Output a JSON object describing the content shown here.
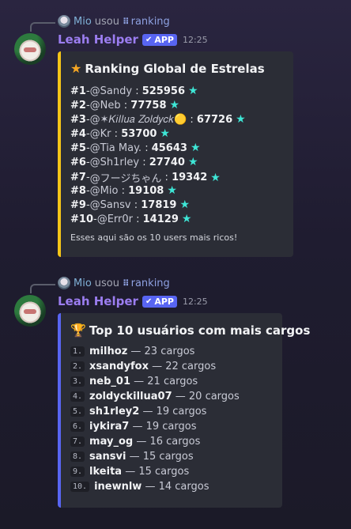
{
  "messages": [
    {
      "reply": {
        "user": "Mio",
        "verb": "usou",
        "command": "ranking"
      },
      "author": "Leah Helper",
      "badge": "APP",
      "time": "12:25",
      "embed": {
        "accent": "#f5c518",
        "title_icon": "star-icon",
        "title": "Ranking Global de Estrelas",
        "rows": [
          {
            "pos": "#1",
            "sep": " - ",
            "user": "@Sandy",
            "value": "525956"
          },
          {
            "pos": "#2",
            "sep": " - ",
            "user": "@Neb",
            "value": "77758"
          },
          {
            "pos": "#3",
            "sep": " - ",
            "user": "@✶𝐾𝑖𝑙𝑙𝑢𝑎 𝑍𝑜𝑙𝑑𝑦𝑐𝑘🟡",
            "value": "67726"
          },
          {
            "pos": "#4",
            "sep": " - ",
            "user": "@Kr",
            "value": "53700"
          },
          {
            "pos": "#5",
            "sep": " - ",
            "user": "@Tia May.",
            "value": "45643"
          },
          {
            "pos": "#6",
            "sep": " - ",
            "user": "@Sh1rley",
            "value": "27740"
          },
          {
            "pos": "#7",
            "sep": " - ",
            "user": "@フージちゃん",
            "value": "19342"
          },
          {
            "pos": "#8",
            "sep": " - ",
            "user": "@Mio",
            "value": "19108"
          },
          {
            "pos": "#9",
            "sep": " - ",
            "user": "@Sansv",
            "value": "17819"
          },
          {
            "pos": "#10",
            "sep": " - ",
            "user": "@Err0r",
            "value": "14129"
          }
        ],
        "footer": "Esses aqui são os 10 users mais ricos!"
      }
    },
    {
      "reply": {
        "user": "Mio",
        "verb": "usou",
        "command": "ranking"
      },
      "author": "Leah Helper",
      "badge": "APP",
      "time": "12:25",
      "embed": {
        "accent": "#5865f2",
        "title_icon": "trophy-icon",
        "title": "Top 10 usuários com mais cargos",
        "rows": [
          {
            "num": "1.",
            "user": "milhoz",
            "count": "— 23 cargos"
          },
          {
            "num": "2.",
            "user": "xsandyfox",
            "count": "— 22 cargos"
          },
          {
            "num": "3.",
            "user": "neb_01",
            "count": "— 21 cargos"
          },
          {
            "num": "4.",
            "user": "zoldyckillua07",
            "count": "— 20 cargos"
          },
          {
            "num": "5.",
            "user": "sh1rley2",
            "count": "— 19 cargos"
          },
          {
            "num": "6.",
            "user": "iykira7",
            "count": "— 19 cargos"
          },
          {
            "num": "7.",
            "user": "may_og",
            "count": "— 16 cargos"
          },
          {
            "num": "8.",
            "user": "sansvi",
            "count": "— 15 cargos"
          },
          {
            "num": "9.",
            "user": "lkeita",
            "count": "— 15 cargos"
          },
          {
            "num": "10.",
            "user": "inewnlw",
            "count": "— 14 cargos"
          }
        ]
      }
    }
  ]
}
